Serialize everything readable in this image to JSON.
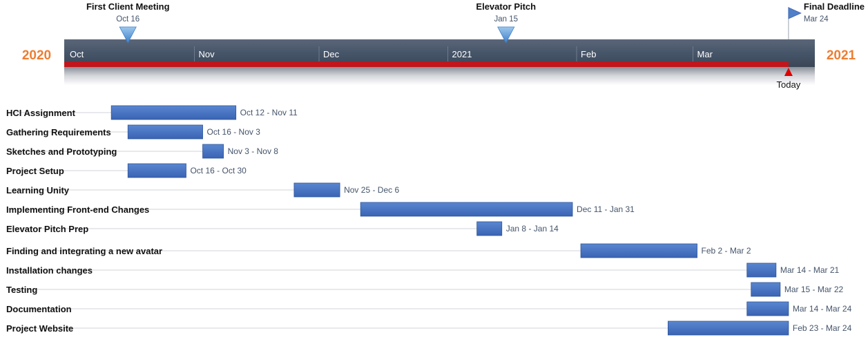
{
  "chart_data": {
    "type": "gantt",
    "colors": {
      "year_label": "#ed7d31",
      "band": "#475569",
      "progress": "#c0161c",
      "bar": "#4472c4",
      "milestone": "#5b9bd5",
      "today_marker": "#e00000"
    },
    "timeline": {
      "start": "2020-10-01",
      "end": "2021-03-30",
      "start_year_label": "2020",
      "end_year_label": "2021",
      "today": "2021-03-24",
      "today_label": "Today",
      "months": [
        {
          "label": "Oct",
          "date": "2020-10-01"
        },
        {
          "label": "Nov",
          "date": "2020-11-01"
        },
        {
          "label": "Dec",
          "date": "2020-12-01"
        },
        {
          "label": "2021",
          "date": "2021-01-01"
        },
        {
          "label": "Feb",
          "date": "2021-02-01"
        },
        {
          "label": "Mar",
          "date": "2021-03-01"
        }
      ]
    },
    "milestones": [
      {
        "title": "First Client Meeting",
        "date_label": "Oct 16",
        "date": "2020-10-16",
        "marker": "triangle-down"
      },
      {
        "title": "Elevator Pitch",
        "date_label": "Jan 15",
        "date": "2021-01-15",
        "marker": "triangle-down"
      },
      {
        "title": "Final Deadline",
        "date_label": "Mar 24",
        "date": "2021-03-24",
        "marker": "flag"
      }
    ],
    "tasks": [
      {
        "name": "HCI Assignment",
        "start": "2020-10-12",
        "end": "2020-11-11",
        "dates_label": "Oct 12 - Nov 11"
      },
      {
        "name": "Gathering Requirements",
        "start": "2020-10-16",
        "end": "2020-11-03",
        "dates_label": "Oct 16 - Nov 3"
      },
      {
        "name": "Sketches and Prototyping",
        "start": "2020-11-03",
        "end": "2020-11-08",
        "dates_label": "Nov 3 - Nov 8"
      },
      {
        "name": "Project Setup",
        "start": "2020-10-16",
        "end": "2020-10-30",
        "dates_label": "Oct 16 - Oct 30"
      },
      {
        "name": "Learning Unity",
        "start": "2020-11-25",
        "end": "2020-12-06",
        "dates_label": "Nov 25 - Dec 6"
      },
      {
        "name": "Implementing Front-end Changes",
        "start": "2020-12-11",
        "end": "2021-01-31",
        "dates_label": "Dec 11 - Jan 31"
      },
      {
        "name": "Elevator Pitch Prep",
        "start": "2021-01-08",
        "end": "2021-01-14",
        "dates_label": "Jan 8 - Jan 14"
      },
      {
        "name": "Finding and integrating a new avatar",
        "start": "2021-02-02",
        "end": "2021-03-02",
        "dates_label": "Feb 2 - Mar 2"
      },
      {
        "name": "Installation changes",
        "start": "2021-03-14",
        "end": "2021-03-21",
        "dates_label": "Mar 14 - Mar 21"
      },
      {
        "name": "Testing",
        "start": "2021-03-15",
        "end": "2021-03-22",
        "dates_label": "Mar 15 - Mar 22"
      },
      {
        "name": "Documentation",
        "start": "2021-03-14",
        "end": "2021-03-24",
        "dates_label": "Mar 14 - Mar 24"
      },
      {
        "name": "Project Website",
        "start": "2021-02-23",
        "end": "2021-03-24",
        "dates_label": "Feb 23 - Mar 24"
      }
    ]
  }
}
